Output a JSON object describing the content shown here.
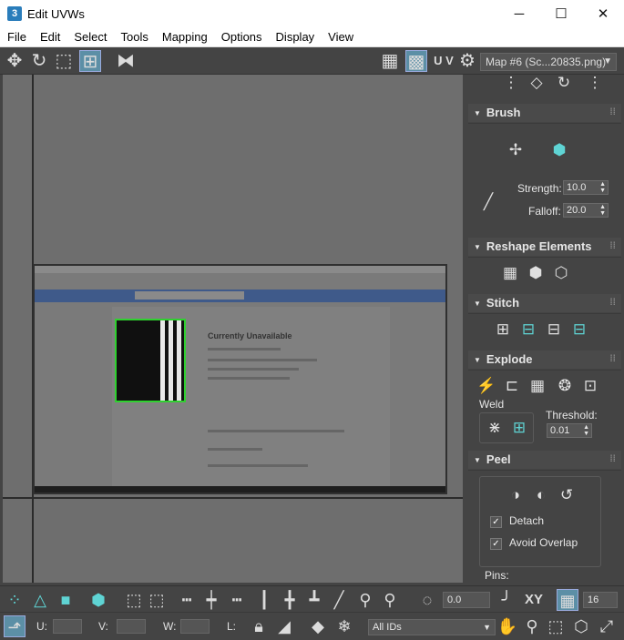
{
  "window": {
    "app_icon_text": "3",
    "title": "Edit UVWs",
    "minimize_label": "─",
    "maximize_label": "☐",
    "close_label": "✕"
  },
  "menu": {
    "items": [
      "File",
      "Edit",
      "Select",
      "Tools",
      "Mapping",
      "Options",
      "Display",
      "View"
    ]
  },
  "toolbar": {
    "uv_label": "U V",
    "map_select_value": "Map #6 (Sc...20835.png)"
  },
  "texture_preview": {
    "heading": "Currently Unavailable"
  },
  "panel": {
    "brush": {
      "title": "Brush",
      "strength_label": "Strength:",
      "strength_value": "10.0",
      "falloff_label": "Falloff:",
      "falloff_value": "20.0"
    },
    "reshape": {
      "title": "Reshape Elements"
    },
    "stitch": {
      "title": "Stitch"
    },
    "explode": {
      "title": "Explode",
      "weld_label": "Weld",
      "threshold_label": "Threshold:",
      "threshold_value": "0.01"
    },
    "peel": {
      "title": "Peel",
      "detach_label": "Detach",
      "detach_checked": true,
      "avoid_overlap_label": "Avoid Overlap",
      "avoid_overlap_checked": true,
      "pins_label": "Pins:"
    }
  },
  "bottom": {
    "angle_value": "0.0",
    "xy_label": "XY",
    "grid_value": "16",
    "u_label": "U:",
    "v_label": "V:",
    "w_label": "W:",
    "l_label": "L:",
    "ids_value": "All IDs"
  },
  "colors": {
    "background": "#444444",
    "viewport": "#6e6e6e",
    "accent": "#5fd4d4",
    "selection_green": "#2fd12f"
  }
}
